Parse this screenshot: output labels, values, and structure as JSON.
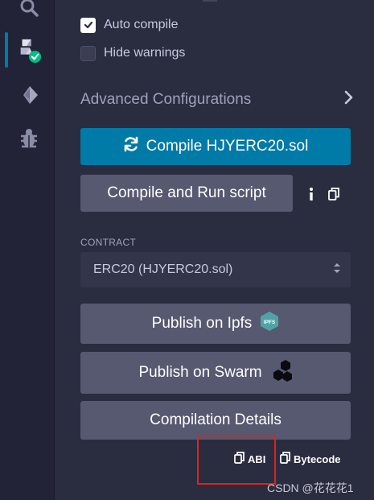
{
  "icon_bar": {
    "items": [
      {
        "name": "search",
        "active": false
      },
      {
        "name": "solidity-compiler",
        "active": true
      },
      {
        "name": "deploy-run",
        "active": false
      },
      {
        "name": "debugger",
        "active": false
      }
    ]
  },
  "options": {
    "auto_compile": {
      "label": "Auto compile",
      "checked": true
    },
    "hide_warnings": {
      "label": "Hide warnings",
      "checked": false
    }
  },
  "advanced": {
    "label": "Advanced Configurations"
  },
  "buttons": {
    "compile": "Compile HJYERC20.sol",
    "compile_run": "Compile and Run script",
    "publish_ipfs": "Publish on Ipfs",
    "publish_swarm": "Publish on Swarm",
    "compilation_details": "Compilation Details"
  },
  "contract": {
    "label": "CONTRACT",
    "selected": "ERC20 (HJYERC20.sol)"
  },
  "copy": {
    "abi": "ABI",
    "bytecode": "Bytecode"
  },
  "badges": {
    "ipfs": "IPFS"
  },
  "watermark": "CSDN @花花花1",
  "colors": {
    "primary": "#007aa6",
    "secondary_button": "#565970",
    "panel_bg": "#2a2c3f",
    "highlight": "#e0221c",
    "success": "#00bf84"
  }
}
